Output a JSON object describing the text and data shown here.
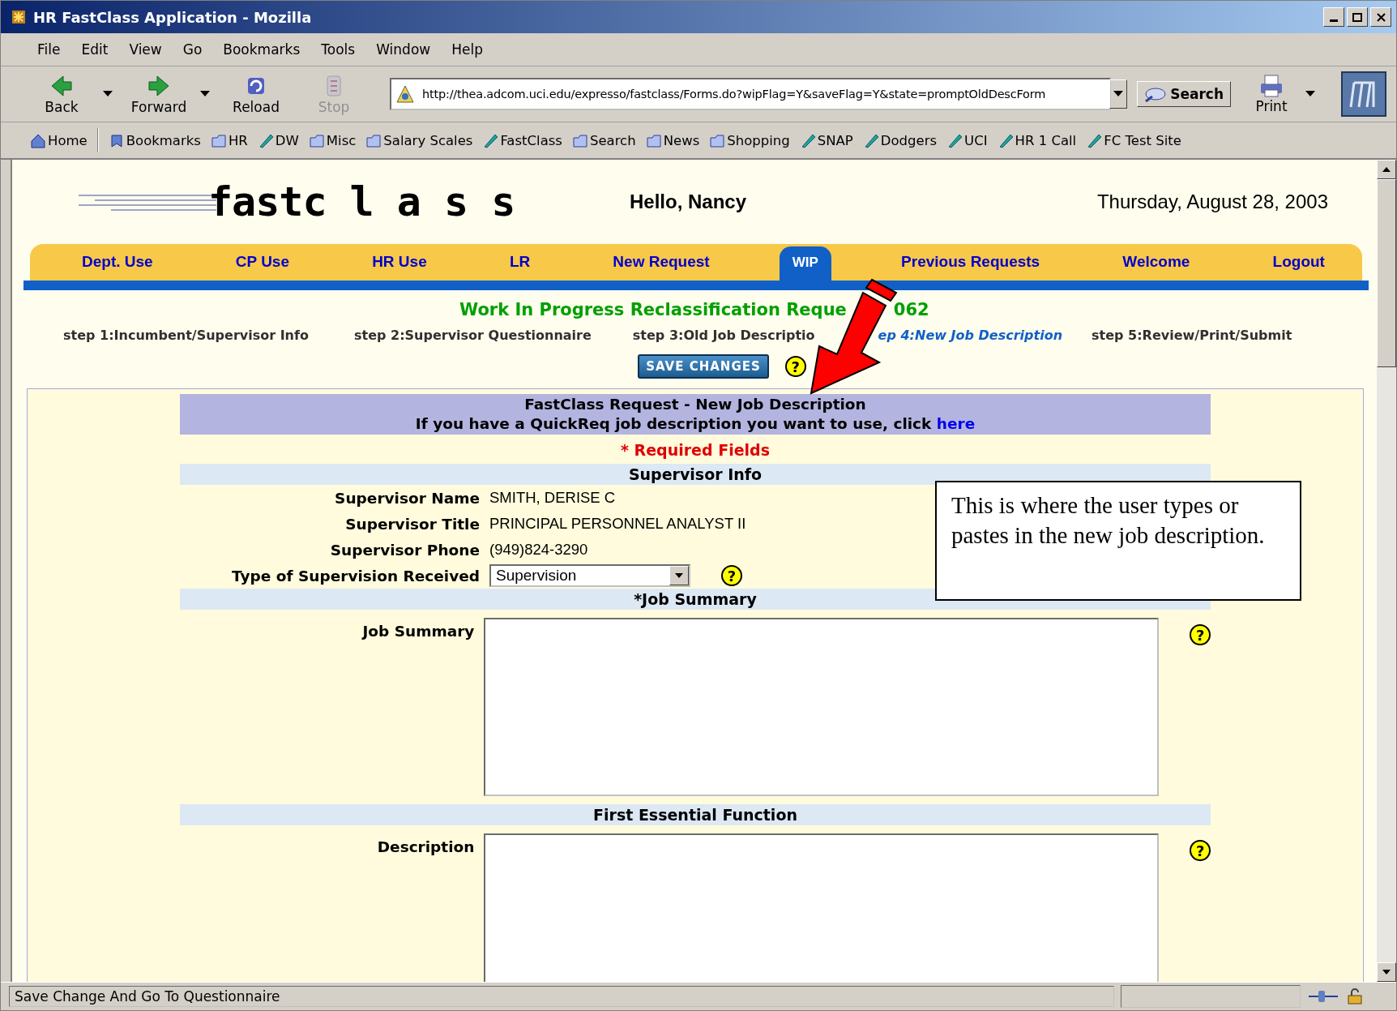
{
  "window": {
    "title": "HR FastClass Application - Mozilla"
  },
  "menu": [
    "File",
    "Edit",
    "View",
    "Go",
    "Bookmarks",
    "Tools",
    "Window",
    "Help"
  ],
  "toolbar": [
    {
      "label": "Back",
      "kind": "back",
      "disabled": false
    },
    {
      "label": "Forward",
      "kind": "forward",
      "disabled": false
    },
    {
      "label": "Reload",
      "kind": "reload",
      "disabled": false
    },
    {
      "label": "Stop",
      "kind": "stop",
      "disabled": true
    }
  ],
  "address": {
    "value": "http://thea.adcom.uci.edu/expresso/fastclass/Forms.do?wipFlag=Y&saveFlag=Y&state=promptOldDescForm"
  },
  "search_button": "Search",
  "print_button": "Print",
  "bookmarks": [
    {
      "label": "Home",
      "kind": "home"
    },
    {
      "label": "Bookmarks",
      "kind": "bookmarks"
    },
    {
      "label": "HR",
      "kind": "folder"
    },
    {
      "label": "DW",
      "kind": "link"
    },
    {
      "label": "Misc",
      "kind": "folder"
    },
    {
      "label": "Salary Scales",
      "kind": "folder"
    },
    {
      "label": "FastClass",
      "kind": "link"
    },
    {
      "label": "Search",
      "kind": "folder"
    },
    {
      "label": "News",
      "kind": "folder"
    },
    {
      "label": "Shopping",
      "kind": "folder"
    },
    {
      "label": "SNAP",
      "kind": "link"
    },
    {
      "label": "Dodgers",
      "kind": "link"
    },
    {
      "label": "UCI",
      "kind": "link"
    },
    {
      "label": "HR 1 Call",
      "kind": "link"
    },
    {
      "label": "FC Test Site",
      "kind": "link"
    }
  ],
  "page": {
    "logo": "fastc l a s s",
    "greeting": "Hello, Nancy",
    "date": "Thursday, August 28, 2003",
    "nav_tabs": [
      {
        "label": "Dept. Use",
        "selected": false
      },
      {
        "label": "CP Use",
        "selected": false
      },
      {
        "label": "HR Use",
        "selected": false
      },
      {
        "label": "LR",
        "selected": false
      },
      {
        "label": "New Request",
        "selected": false
      },
      {
        "label": "WIP",
        "selected": true
      },
      {
        "label": "Previous Requests",
        "selected": false
      },
      {
        "label": "Welcome",
        "selected": false
      },
      {
        "label": "Logout",
        "selected": false
      }
    ],
    "title_parts": [
      "Work In Progress Reclassification Reque",
      "062"
    ],
    "steps": [
      {
        "label": "step 1:Incumbent/Supervisor Info",
        "selected": false
      },
      {
        "label": "step 2:Supervisor Questionnaire",
        "selected": false
      },
      {
        "label": "step 3:Old Job Descriptio",
        "selected": false
      },
      {
        "label": "ep 4:New Job Description",
        "selected": true
      },
      {
        "label": "step 5:Review/Print/Submit",
        "selected": false
      }
    ],
    "save_button": "SAVE CHANGES",
    "help_icon": "?",
    "form": {
      "heading": "FastClass Request - New Job Description",
      "subheading": "If you have a QuickReq job description you want to use, click",
      "subheading_link": "here",
      "required_note": "* Required Fields",
      "supervisor_header": "Supervisor Info",
      "supervisor_rows": [
        {
          "label": "Supervisor Name",
          "value": "SMITH, DERISE C"
        },
        {
          "label": "Supervisor Title",
          "value": "PRINCIPAL PERSONNEL ANALYST II"
        },
        {
          "label": "Supervisor Phone",
          "value": "(949)824-3290"
        }
      ],
      "supervision_type": {
        "label": "Type of Supervision Received",
        "value": "Supervision"
      },
      "job_summary_header": "*Job Summary",
      "job_summary_label": "Job Summary",
      "function_header": "First Essential Function",
      "description_label": "Description"
    }
  },
  "callout": {
    "text": "This is where the user types or pastes in the new job description."
  },
  "status_bar": {
    "text": "Save Change And Go To Questionnaire"
  }
}
